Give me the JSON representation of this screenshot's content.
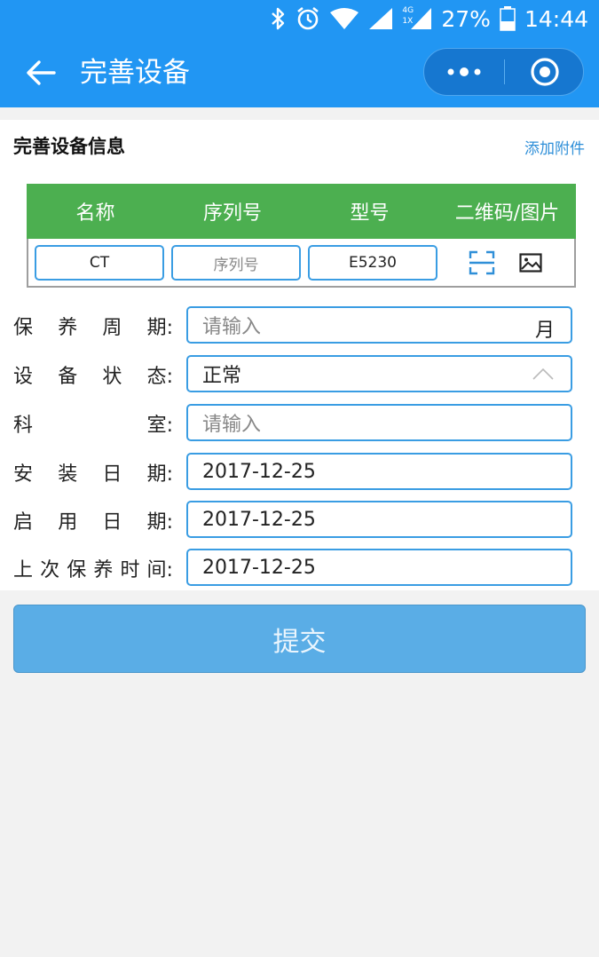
{
  "status_bar": {
    "battery_text": "27%",
    "time": "14:44",
    "network_label": "4G",
    "network_sub": "1X",
    "icons": [
      "bluetooth-icon",
      "alarm-icon",
      "wifi-icon",
      "signal-icon",
      "signal-4g-icon",
      "battery-icon"
    ]
  },
  "nav": {
    "title": "完善设备",
    "back_icon": "arrow-left-icon",
    "more_icon": "more-dots-icon",
    "target_icon": "target-icon"
  },
  "section": {
    "title": "完善设备信息",
    "attach_link": "添加附件"
  },
  "table": {
    "headers": [
      "名称",
      "序列号",
      "型号",
      "二维码/图片"
    ],
    "row": {
      "name": "CT",
      "serial_placeholder": "序列号",
      "model": "E5230"
    }
  },
  "form": {
    "maintenance_cycle": {
      "label_chars": [
        "保",
        "养",
        "周",
        "期:"
      ],
      "placeholder": "请输入",
      "suffix": "月"
    },
    "device_status": {
      "label_chars": [
        "设",
        "备",
        "状",
        "态:"
      ],
      "value": "正常"
    },
    "department": {
      "label_chars": [
        "科",
        "室:"
      ],
      "placeholder": "请输入"
    },
    "install_date": {
      "label_chars": [
        "安",
        "装",
        "日",
        "期:"
      ],
      "value": "2017-12-25"
    },
    "enable_date": {
      "label_chars": [
        "启",
        "用",
        "日",
        "期:"
      ],
      "value": "2017-12-25"
    },
    "last_maintenance": {
      "label_chars": [
        "上",
        "次",
        "保",
        "养",
        "时",
        "间:"
      ],
      "value": "2017-12-25"
    }
  },
  "submit_label": "提交",
  "colors": {
    "header_blue": "#2196f3",
    "table_header_green": "#4caf50",
    "field_border": "#3a9de3",
    "submit_bg": "#5aade6"
  }
}
